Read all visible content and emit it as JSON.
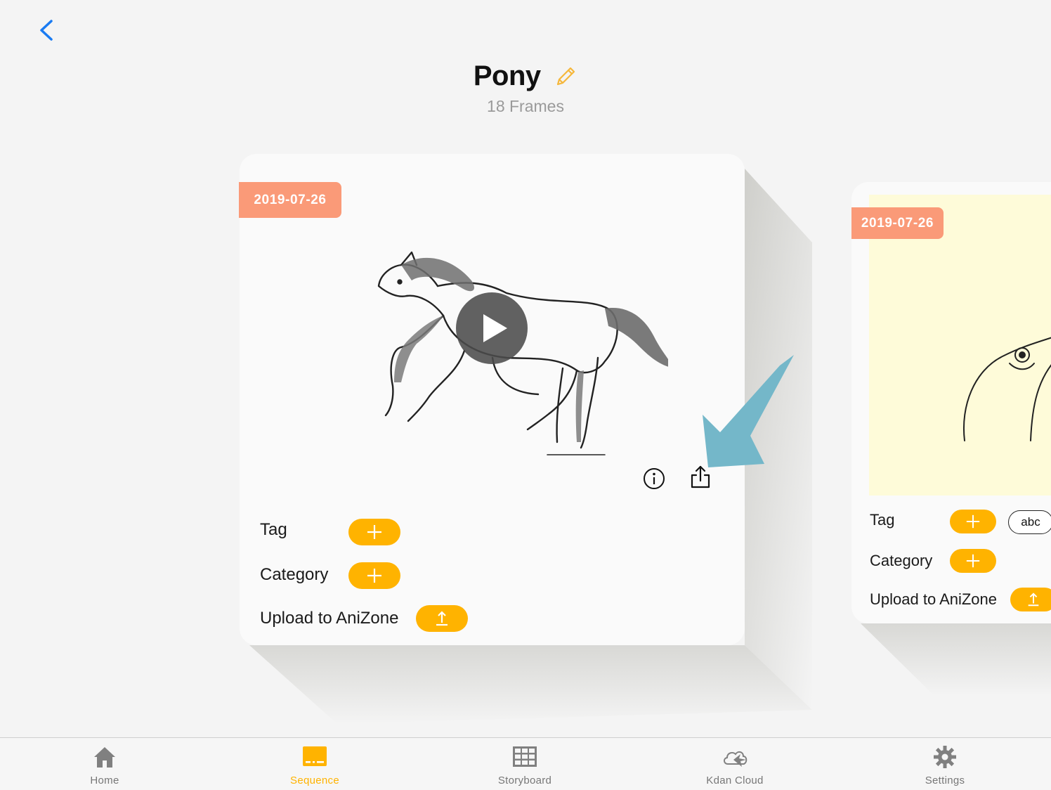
{
  "header": {
    "title": "Pony",
    "subtitle": "18 Frames"
  },
  "icons": {
    "back": "chevron-left-icon",
    "edit": "pencil-icon",
    "play": "play-icon",
    "info": "info-icon",
    "share": "share-icon",
    "add": "plus-icon",
    "upload": "upload-icon"
  },
  "cards": [
    {
      "date": "2019-07-26",
      "tag_label": "Tag",
      "category_label": "Category",
      "upload_label": "Upload to AniZone"
    },
    {
      "date": "2019-07-26",
      "tag_label": "Tag",
      "tag_chip": "abc",
      "category_label": "Category",
      "upload_label": "Upload to AniZone"
    }
  ],
  "tabbar": {
    "items": [
      {
        "label": "Home",
        "icon": "house-icon"
      },
      {
        "label": "Sequence",
        "icon": "sequence-icon",
        "active": true
      },
      {
        "label": "Storyboard",
        "icon": "grid-icon"
      },
      {
        "label": "Kdan Cloud",
        "icon": "cloud-icon"
      },
      {
        "label": "Settings",
        "icon": "gear-icon"
      }
    ]
  },
  "colors": {
    "accent": "#ffb300",
    "date_badge": "#fa9a78",
    "back_blue": "#1a7bf2",
    "callout_arrow": "#74b7c9"
  }
}
